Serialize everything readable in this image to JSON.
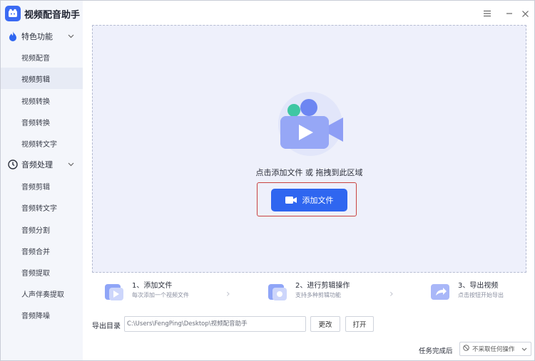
{
  "app": {
    "title": "视频配音助手"
  },
  "window_controls": {
    "menu_icon": "menu-icon",
    "minimize_icon": "minimize-icon",
    "close_icon": "close-icon"
  },
  "sidebar": {
    "groups": [
      {
        "label": "特色功能",
        "icon": "fire-icon",
        "items": [
          {
            "label": "视频配音",
            "active": false
          },
          {
            "label": "视频剪辑",
            "active": true
          },
          {
            "label": "视频转换",
            "active": false
          },
          {
            "label": "音频转换",
            "active": false
          },
          {
            "label": "视频转文字",
            "active": false
          }
        ]
      },
      {
        "label": "音频处理",
        "icon": "clock-icon",
        "items": [
          {
            "label": "音频剪辑",
            "active": false
          },
          {
            "label": "音频转文字",
            "active": false
          },
          {
            "label": "音频分割",
            "active": false
          },
          {
            "label": "音频合并",
            "active": false
          },
          {
            "label": "音频提取",
            "active": false
          },
          {
            "label": "人声伴奏提取",
            "active": false
          },
          {
            "label": "音频降噪",
            "active": false
          }
        ]
      }
    ]
  },
  "dropzone": {
    "hint": "点击添加文件 或 拖拽到此区域",
    "add_button": "添加文件"
  },
  "steps": [
    {
      "title": "1、添加文件",
      "subtitle": "每次添加一个视频文件"
    },
    {
      "title": "2、进行剪辑操作",
      "subtitle": "支持多种剪辑功能"
    },
    {
      "title": "3、导出视频",
      "subtitle": "点击按钮开始导出"
    }
  ],
  "export": {
    "label": "导出目录",
    "path": "C:\\Users\\FengPing\\Desktop\\视频配音助手",
    "change_button": "更改",
    "open_button": "打开"
  },
  "task": {
    "label": "任务完成后",
    "selected": "不采取任何操作"
  },
  "colors": {
    "accent": "#2f66f0",
    "highlight_border": "#c8423f",
    "sidebar_bg": "#f4f6fb",
    "dropzone_bg": "#eef0fb"
  }
}
